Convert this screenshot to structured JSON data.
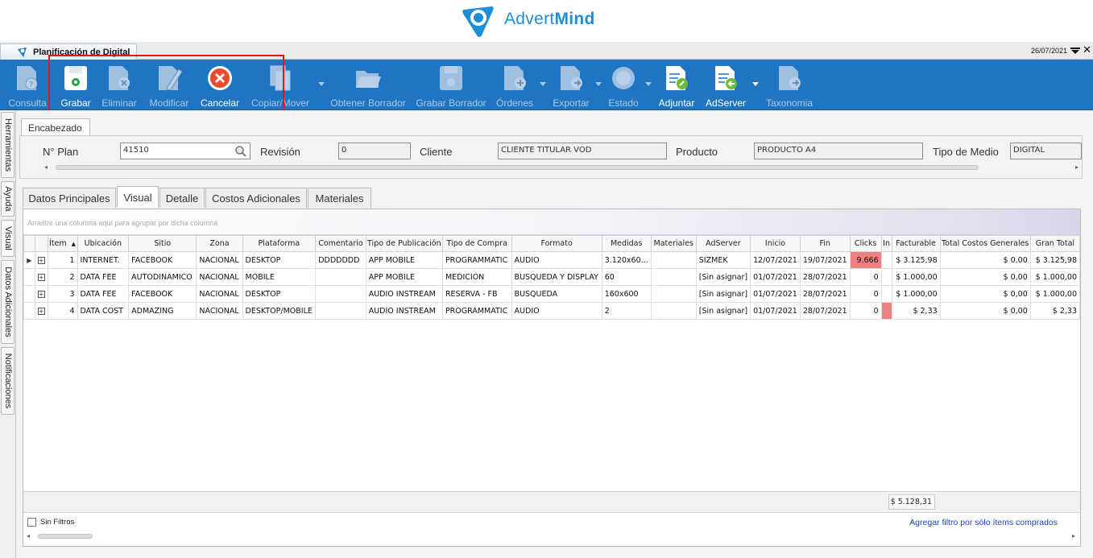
{
  "brand": {
    "name_light": "Advert",
    "name_bold": "Mind",
    "color": "#1e8fd6"
  },
  "window": {
    "tab_title": "Planificación de Digital",
    "date": "26/07/2021",
    "close": "✕"
  },
  "ribbon": {
    "background": "#1f75c2",
    "buttons": [
      {
        "label": "Consulta",
        "enabled": false,
        "icon": "consult-icon"
      },
      {
        "label": "Grabar",
        "enabled": true,
        "icon": "save-icon"
      },
      {
        "label": "Eliminar",
        "enabled": false,
        "icon": "delete-icon"
      },
      {
        "label": "Modificar",
        "enabled": false,
        "icon": "edit-icon"
      },
      {
        "label": "Cancelar",
        "enabled": true,
        "icon": "cancel-icon"
      },
      {
        "label": "Copiar/Mover",
        "enabled": false,
        "icon": "copy-icon"
      },
      {
        "label": "Obtener Borrador",
        "enabled": false,
        "icon": "folder-open-icon"
      },
      {
        "label": "Grabar Borrador",
        "enabled": false,
        "icon": "save-draft-icon"
      },
      {
        "label": "Órdenes",
        "enabled": false,
        "icon": "orders-icon"
      },
      {
        "label": "Exportar",
        "enabled": false,
        "icon": "export-icon"
      },
      {
        "label": "Estado",
        "enabled": false,
        "icon": "status-icon"
      },
      {
        "label": "Adjuntar",
        "enabled": true,
        "icon": "attach-icon"
      },
      {
        "label": "AdServer",
        "enabled": true,
        "icon": "adserver-icon"
      },
      {
        "label": "Taxonomia",
        "enabled": false,
        "icon": "taxonomy-icon"
      }
    ]
  },
  "sidebar": {
    "tabs": [
      "Herramientas",
      "Ayuda",
      "Visual",
      "Datos Adicionales",
      "Notificaciones"
    ]
  },
  "header": {
    "tab": "Encabezado",
    "fields": {
      "plan_label": "N° Plan",
      "plan_value": "41510",
      "revision_label": "Revisión",
      "revision_value": "0",
      "cliente_label": "Cliente",
      "cliente_value": "CLIENTE TITULAR VOD",
      "producto_label": "Producto",
      "producto_value": "PRODUCTO A4",
      "medio_label": "Tipo de Medio",
      "medio_value": "DIGITAL"
    }
  },
  "tabs": [
    "Datos Principales",
    "Visual",
    "Detalle",
    "Costos Adicionales",
    "Materiales"
  ],
  "active_tab": "Visual",
  "grid": {
    "group_hint": "Arrastre una columna aquí para agrupar por dicha columna",
    "columns": [
      "Ítem",
      "Ubicación",
      "Sitio",
      "Zona",
      "Plataforma",
      "Comentario",
      "Tipo de Publicación",
      "Tipo de Compra",
      "Formato",
      "Medidas",
      "Materiales",
      "AdServer",
      "Inicio",
      "Fin",
      "Clicks",
      "In",
      "Facturable",
      "Total Costos Generales",
      "Gran Total"
    ],
    "rows": [
      {
        "item": "1",
        "ubicacion": "INTERNET.",
        "sitio": "FACEBOOK",
        "zona": "NACIONAL",
        "plataforma": "DESKTOP",
        "comentario": "DDDDDDD",
        "tipo_pub": "APP MOBILE",
        "tipo_compra": "PROGRAMMATIC",
        "formato": "AUDIO",
        "medidas": "3.120x60...",
        "materiales": "",
        "adserver": "SIZMEK",
        "inicio": "12/07/2021",
        "fin": "19/07/2021",
        "clicks": "9.666",
        "in": "",
        "facturable": "$ 3.125,98",
        "tcg": "$ 0,00",
        "gran_total": "$ 3.125,98"
      },
      {
        "item": "2",
        "ubicacion": "DATA FEE",
        "sitio": "AUTODINAMICO",
        "zona": "NACIONAL",
        "plataforma": "MOBILE",
        "comentario": "",
        "tipo_pub": "APP MOBILE",
        "tipo_compra": "MEDICION",
        "formato": "BUSQUEDA Y DISPLAY",
        "medidas": "60",
        "materiales": "",
        "adserver": "[Sin asignar]",
        "inicio": "01/07/2021",
        "fin": "28/07/2021",
        "clicks": "0",
        "in": "",
        "facturable": "$ 1.000,00",
        "tcg": "$ 0,00",
        "gran_total": "$ 1.000,00"
      },
      {
        "item": "3",
        "ubicacion": "DATA FEE",
        "sitio": "FACEBOOK",
        "zona": "NACIONAL",
        "plataforma": "DESKTOP",
        "comentario": "",
        "tipo_pub": "AUDIO INSTREAM",
        "tipo_compra": "RESERVA - FB",
        "formato": "BUSQUEDA",
        "medidas": "160x600",
        "materiales": "",
        "adserver": "[Sin asignar]",
        "inicio": "01/07/2021",
        "fin": "28/07/2021",
        "clicks": "0",
        "in": "",
        "facturable": "$ 1.000,00",
        "tcg": "$ 0,00",
        "gran_total": "$ 1.000,00"
      },
      {
        "item": "4",
        "ubicacion": "DATA COST",
        "sitio": "ADMAZING",
        "zona": "NACIONAL",
        "plataforma": "DESKTOP/MOBILE",
        "comentario": "",
        "tipo_pub": "AUDIO INSTREAM",
        "tipo_compra": "PROGRAMMATIC",
        "formato": "AUDIO",
        "medidas": "2",
        "materiales": "",
        "adserver": "[Sin asignar]",
        "inicio": "01/07/2021",
        "fin": "28/07/2021",
        "clicks": "0",
        "in": "",
        "facturable": "$ 2,33",
        "tcg": "$ 0,00",
        "gran_total": "$ 2,33"
      }
    ],
    "total_facturable": "$ 5.128,31",
    "highlight_color": "#f08080"
  },
  "footer": {
    "sin_filtros": "Sin Filtros",
    "add_filter_link": "Agregar filtro por sólo ítems comprados"
  }
}
